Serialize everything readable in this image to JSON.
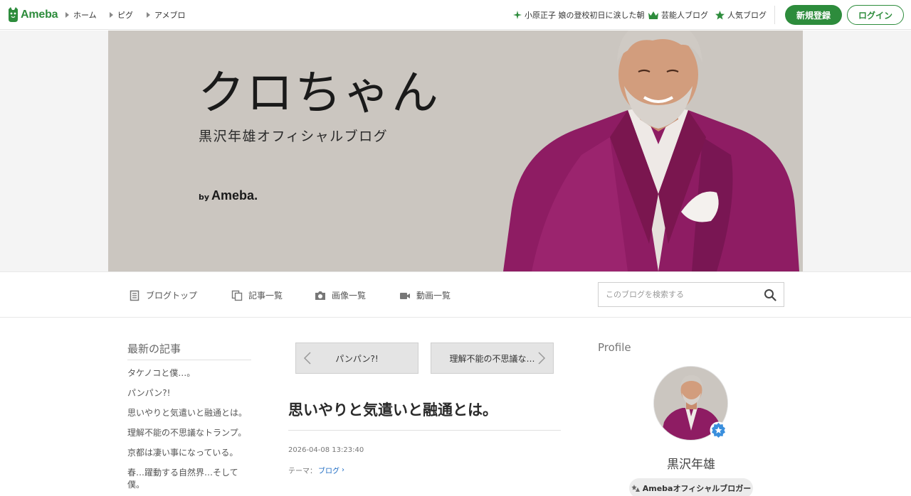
{
  "topnav": {
    "logo_text": "Ameba",
    "breadcrumbs": [
      "ホーム",
      "ピグ",
      "アメブロ"
    ],
    "trending": "小原正子 娘の登校初日に涙した朝",
    "celebrity_blogs": "芸能人ブログ",
    "popular_blogs": "人気ブログ",
    "register_label": "新規登録",
    "login_label": "ログイン",
    "brand_color": "#2d8c3c"
  },
  "banner": {
    "title": "クロちゃん",
    "subtitle": "黒沢年雄オフィシャルブログ",
    "by_label": "by",
    "by_brand": "Ameba."
  },
  "blognav": {
    "items": [
      {
        "label": "ブログトップ",
        "icon": "document-icon"
      },
      {
        "label": "記事一覧",
        "icon": "copy-icon"
      },
      {
        "label": "画像一覧",
        "icon": "camera-icon"
      },
      {
        "label": "動画一覧",
        "icon": "video-icon"
      }
    ],
    "search_placeholder": "このブログを検索する"
  },
  "sidebar": {
    "heading": "最新の記事",
    "recent": [
      "タケノコと僕…。",
      "パンパン?!",
      "思いやりと気遣いと融通とは。",
      "理解不能の不思議なトランプ。",
      "京都は凄い事になっている。",
      "春…躍動する自然界…そして僕。"
    ]
  },
  "article": {
    "prev_label": "パンパン?!",
    "next_label": "理解不能の不思議な…",
    "title": "思いやりと気遣いと融通とは。",
    "datetime": "2026-04-08 13:23:40",
    "theme_prefix": "テーマ：",
    "theme_link": "ブログ",
    "link_color": "#1b69c2"
  },
  "profile": {
    "heading": "Profile",
    "name": "黒沢年雄",
    "badge": "Amebaオフィシャルブロガー"
  }
}
